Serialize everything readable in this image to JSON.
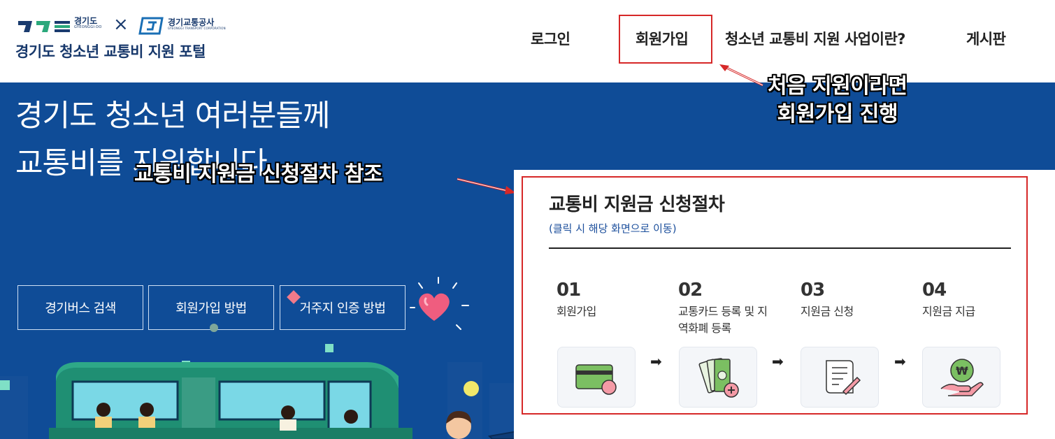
{
  "header": {
    "logo_gyeonggi": "경기도",
    "logo_gyeonggi_en": "GYEONGGI-DO",
    "logo_corp": "경기교통공사",
    "logo_corp_en": "GYEONGGI TRANSPORT CORPORATION",
    "logo_title": "경기도 청소년 교통비 지원 포털",
    "nav": {
      "login": "로그인",
      "signup": "회원가입",
      "about": "청소년 교통비 지원 사업이란?",
      "board": "게시판"
    }
  },
  "hero": {
    "title_line1": "경기도 청소년 여러분들께",
    "title_line2": "교통비를 지원합니다.",
    "buttons": [
      "경기버스 검색",
      "회원가입 방법",
      "거주지 인증 방법"
    ]
  },
  "annotations": {
    "signup_note_line1": "처음 지원이라면",
    "signup_note_line2": "회원가입 진행",
    "procedure_note": "교통비 지원금 신청절차 참조"
  },
  "procedure": {
    "title": "교통비 지원금 신청절차",
    "subtitle": "(클릭 시 해당 화면으로 이동)",
    "steps": [
      {
        "num": "01",
        "label": "회원가입",
        "icon": "card-icon"
      },
      {
        "num": "02",
        "label": "교통카드 등록 및 지역화폐 등록",
        "icon": "money-icon"
      },
      {
        "num": "03",
        "label": "지원금 신청",
        "icon": "document-icon"
      },
      {
        "num": "04",
        "label": "지원금 지급",
        "icon": "won-coin-icon"
      }
    ]
  },
  "colors": {
    "navy": "#17386b",
    "hero_blue": "#0f4c97",
    "highlight_red": "#d62828",
    "accent_green": "#2aa87b"
  }
}
